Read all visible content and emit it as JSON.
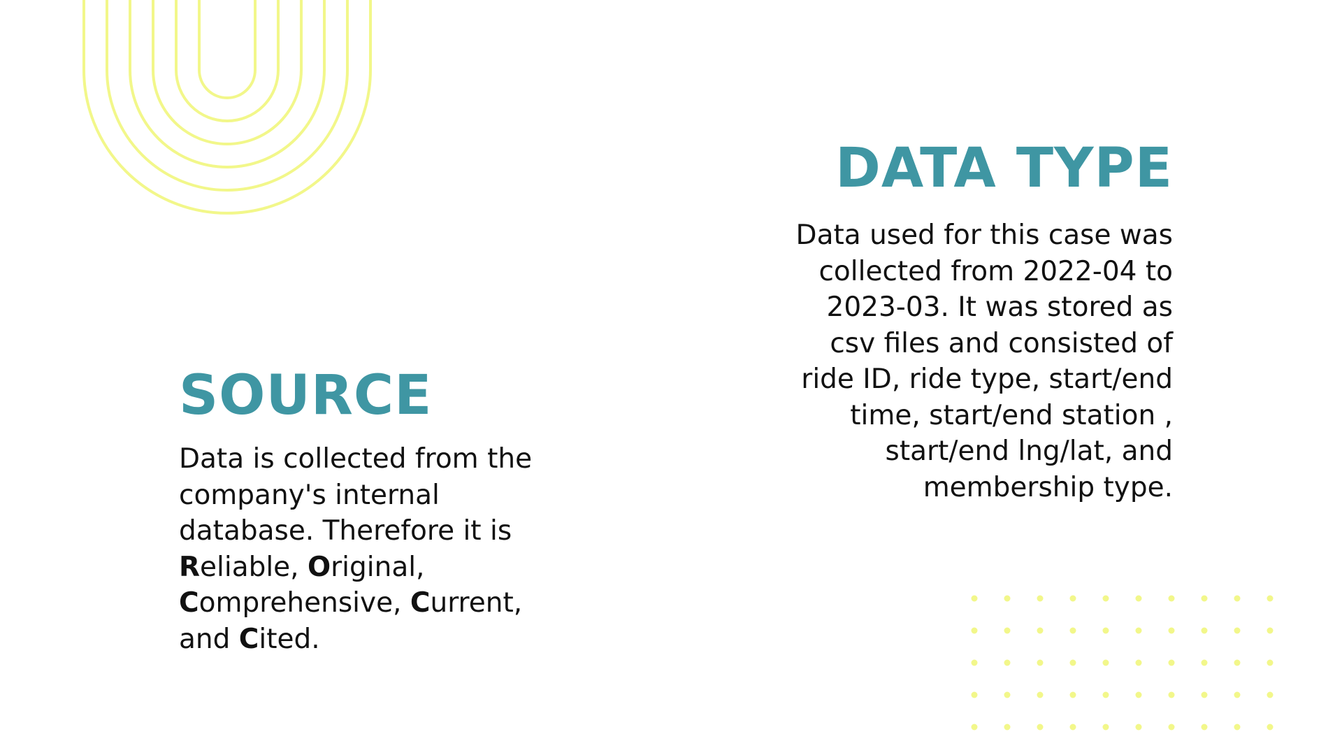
{
  "colors": {
    "heading": "#3f96a3",
    "accent_yellow": "#f2f78a",
    "text": "#111111",
    "background": "#ffffff"
  },
  "decorations": {
    "arcs": "concentric-u-arcs-decoration",
    "dots": "dot-grid-decoration"
  },
  "data_type": {
    "title": "DATA TYPE",
    "lines": [
      "Data used for this case was",
      "collected from 2022-04 to",
      "2023-03. It was stored as",
      "csv files and consisted of",
      "ride ID, ride type, start/end",
      "time, start/end station ,",
      "start/end lng/lat, and",
      "membership type."
    ]
  },
  "source": {
    "title": "SOURCE",
    "line1": "Data is collected from the",
    "line2": "company's internal",
    "line3": "database. Therefore it is",
    "r_initial": "R",
    "r_rest": "eliable, ",
    "o_initial": "O",
    "o_rest": "riginal,",
    "c1_initial": "C",
    "c1_rest": "omprehensive, ",
    "c2_initial": "C",
    "c2_rest": "urrent,",
    "and_prefix": "and ",
    "c3_initial": "C",
    "c3_rest": "ited."
  }
}
